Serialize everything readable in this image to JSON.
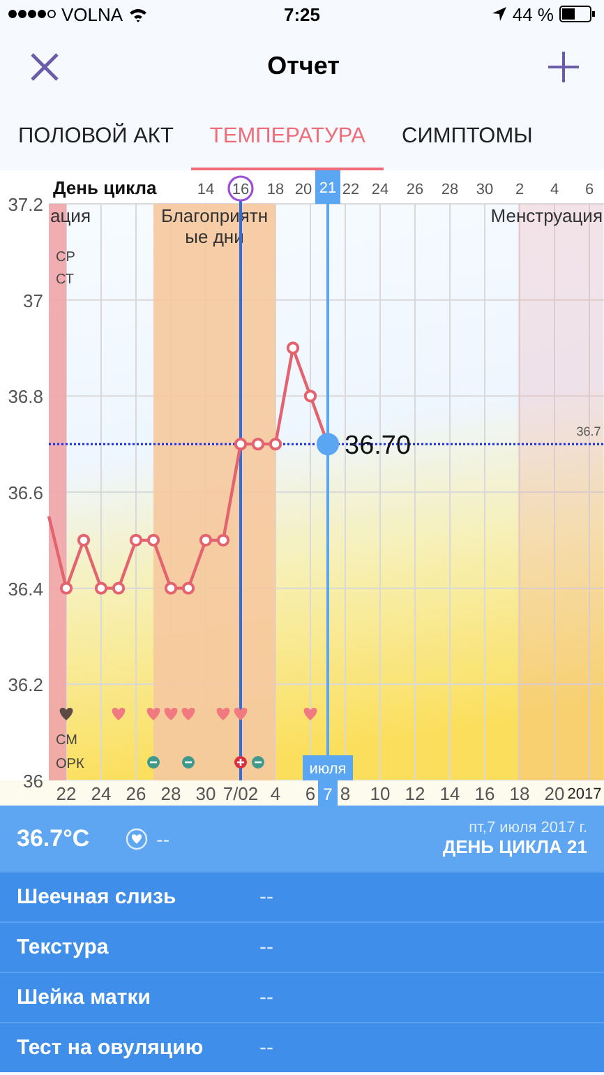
{
  "status_bar": {
    "carrier": "VOLNA",
    "time": "7:25",
    "battery": "44 %"
  },
  "nav": {
    "title": "Отчет"
  },
  "tabs": [
    {
      "label": "ПОЛОВОЙ АКТ",
      "selected": false
    },
    {
      "label": "ТЕМПЕРАТУРА",
      "selected": true
    },
    {
      "label": "СИМПТОМЫ",
      "selected": false
    }
  ],
  "chart": {
    "next_cycle_ticks": [
      "2",
      "4",
      "6"
    ],
    "selected_cycle_day": "21",
    "selected_month": "июля",
    "selected_date": "7",
    "year": "2017",
    "date_labels": [
      "22",
      "24",
      "26",
      "28",
      "30",
      "7/02",
      "4",
      "6",
      "8",
      "10",
      "12",
      "14",
      "16",
      "18",
      "20"
    ],
    "row_labels": [
      "СР",
      "СТ",
      "СМ",
      "ОРК"
    ],
    "days": [
      {
        "measured": true,
        "intercourse": true,
        "color": "#5c4a44"
      },
      {
        "measured": true
      },
      {
        "measured": true
      },
      {
        "measured": true,
        "intercourse": true,
        "color": "#f07a80"
      },
      {
        "measured": true
      },
      {
        "measured": true,
        "intercourse": true,
        "color": "#f07a80",
        "ovulation_test": true,
        "test_positive": false
      },
      {
        "measured": true,
        "intercourse": true,
        "color": "#f07a80"
      },
      {
        "measured": true,
        "intercourse": true,
        "color": "#f07a80",
        "ovulation_test": true,
        "test_positive": false
      },
      {
        "measured": true
      },
      {
        "measured": true,
        "intercourse": true,
        "color": "#f07a80"
      },
      {
        "measured": true,
        "intercourse": true,
        "color": "#f07a80",
        "ovulation_test": true,
        "test_positive": true
      },
      {
        "measured": true,
        "ovulation_test": true,
        "test_positive": false
      },
      {
        "measured": true
      },
      {
        "measured": true
      },
      {
        "measured": true,
        "intercourse": true,
        "color": "#f07a80"
      }
    ],
    "chart_data": {
      "type": "line",
      "xlabel": "День цикла",
      "grid": true,
      "marker": true,
      "x": [
        5,
        6,
        7,
        8,
        9,
        10,
        11,
        12,
        13,
        14,
        15,
        16,
        17,
        18,
        19,
        20,
        21
      ],
      "values": [
        36.55,
        36.4,
        36.5,
        36.4,
        36.4,
        36.5,
        36.5,
        36.4,
        36.4,
        36.5,
        36.5,
        36.7,
        36.7,
        36.7,
        36.9,
        36.8,
        36.7
      ],
      "xlim": [
        5,
        36.84
      ],
      "xticks": [
        14,
        16,
        18,
        20,
        22,
        24,
        26,
        28,
        30
      ],
      "ylim": [
        36,
        37.2
      ],
      "yticks": [
        36,
        36.2,
        36.4,
        36.6,
        36.8,
        37,
        37.2
      ],
      "bands": [
        {
          "axis": "x",
          "from": 5,
          "to": 6,
          "label": "ация",
          "color": "#f0a6aa"
        },
        {
          "axis": "x",
          "from": 11,
          "to": 18,
          "label": "Благоприятные дни",
          "color": "#f5c9a0"
        },
        {
          "axis": "x",
          "from": 31.9,
          "to": 36.8,
          "label": "Менструация",
          "color": "#eea2a8"
        }
      ],
      "ref_lines": [
        {
          "axis": "x",
          "value": 16,
          "color": "#2d6fe3"
        },
        {
          "axis": "x",
          "value": 21,
          "color": "#5aa6f2"
        },
        {
          "axis": "y",
          "value": 36.7,
          "label": "36.7",
          "color": "#1a2ee8"
        }
      ],
      "annotations": [
        {
          "x": 21,
          "y": 36.7,
          "text": "36.70"
        }
      ]
    }
  },
  "summary": {
    "temperature": "36.7°C",
    "intercourse": "--",
    "date": "пт,7 июля 2017 г.",
    "cycle_day": "ДЕНЬ ЦИКЛА 21"
  },
  "rows": [
    {
      "label": "Шеечная слизь",
      "value": "--"
    },
    {
      "label": "Текстура",
      "value": "--"
    },
    {
      "label": "Шейка матки",
      "value": "--"
    },
    {
      "label": "Тест на овуляцию",
      "value": "--"
    }
  ]
}
